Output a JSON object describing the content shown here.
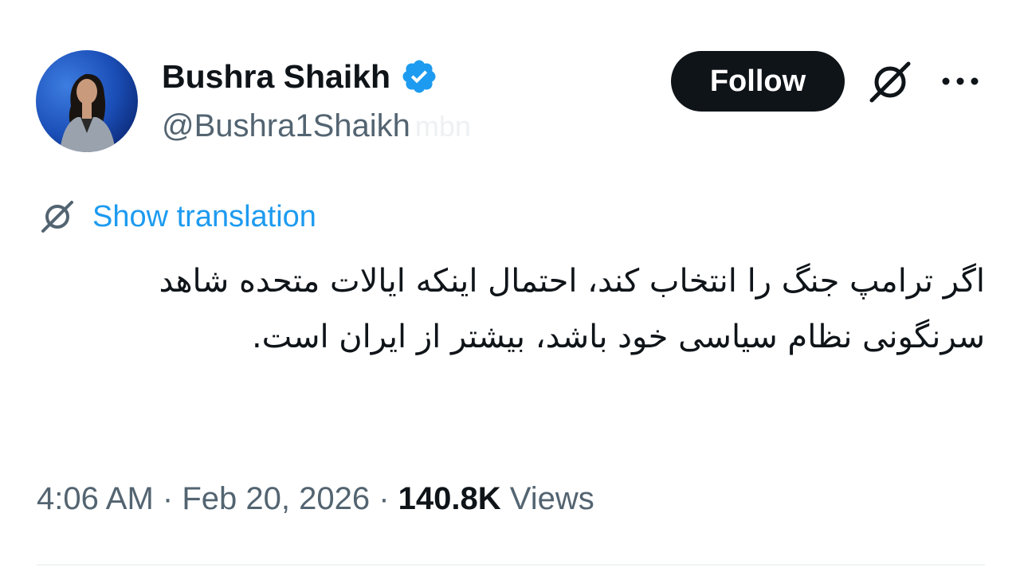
{
  "author": {
    "display_name": "Bushra Shaikh",
    "handle": "@Bushra1Shaikh",
    "verified": true,
    "watermark": "mbn"
  },
  "actions": {
    "follow_label": "Follow",
    "grok_icon": "grok-icon",
    "more_icon": "more-dots-icon"
  },
  "translation": {
    "link_label": "Show translation",
    "icon": "grok-icon"
  },
  "tweet": {
    "text": "اگر ترامپ جنگ را انتخاب کند، احتمال اینکه ایالات متحده شاهد سرنگونی نظام سیاسی خود باشد، بیشتر از ایران است."
  },
  "meta": {
    "time": "4:06 AM",
    "separator": "·",
    "date": "Feb 20, 2026",
    "views_count": "140.8K",
    "views_label": "Views"
  },
  "colors": {
    "text_primary": "#0f1419",
    "text_secondary": "#536471",
    "link": "#1d9bf0",
    "verified": "#1d9bf0",
    "follow_bg": "#0f1419"
  }
}
